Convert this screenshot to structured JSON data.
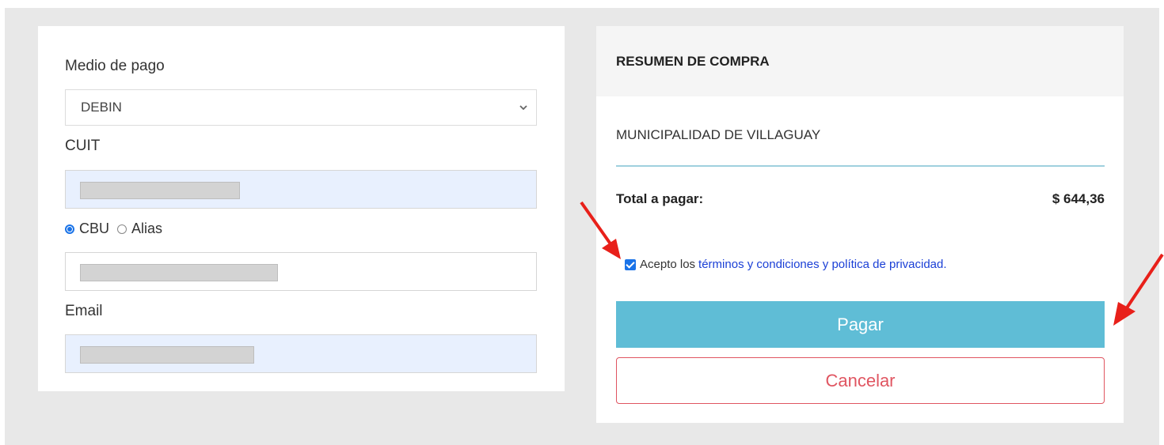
{
  "form": {
    "payment_method_label": "Medio de pago",
    "payment_method_value": "DEBIN",
    "cuit_label": "CUIT",
    "radio_cbu": "CBU",
    "radio_alias": "Alias",
    "email_label": "Email"
  },
  "summary": {
    "header": "RESUMEN DE COMPRA",
    "merchant": "MUNICIPALIDAD DE VILLAGUAY",
    "total_label": "Total a pagar:",
    "total_value": "$ 644,36",
    "terms_prefix": "Acepto los",
    "terms_link": "términos y condiciones y política de privacidad.",
    "pay_button": "Pagar",
    "cancel_button": "Cancelar"
  },
  "colors": {
    "pay_button": "#5fbdd6",
    "cancel_border": "#e05561",
    "autofill_bg": "#e8f0fe",
    "arrow": "#e8201a"
  }
}
